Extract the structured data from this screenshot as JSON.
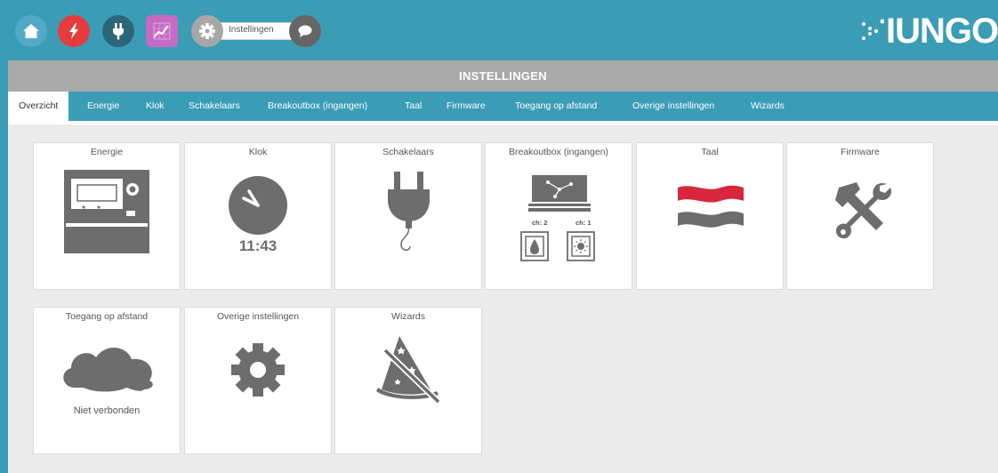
{
  "colors": {
    "header": "#3b9cb5",
    "titlebar": "#a9a9a9",
    "icon_gray": "#6d6d6d",
    "background": "#ececec"
  },
  "nav": {
    "buttons": [
      {
        "icon": "home-icon",
        "color": "#52a9c6"
      },
      {
        "icon": "lightning-icon",
        "color": "#e63b3e"
      },
      {
        "icon": "plug-icon",
        "color": "#2d6678"
      },
      {
        "icon": "chart-icon",
        "color": "#c56bc4"
      }
    ],
    "settings_label": "Instellingen"
  },
  "logo": {
    "text": "IUNGO"
  },
  "page_title": "INSTELLINGEN",
  "tabs": [
    {
      "label": "Overzicht",
      "active": true
    },
    {
      "label": "Energie"
    },
    {
      "label": "Klok"
    },
    {
      "label": "Schakelaars"
    },
    {
      "label": "Breakoutbox (ingangen)"
    },
    {
      "label": "Taal"
    },
    {
      "label": "Firmware"
    },
    {
      "label": "Toegang op afstand"
    },
    {
      "label": "Overige instellingen"
    },
    {
      "label": "Wizards"
    }
  ],
  "tiles": {
    "energie": {
      "title": "Energie"
    },
    "klok": {
      "title": "Klok",
      "time": "11:43"
    },
    "schakelaars": {
      "title": "Schakelaars"
    },
    "breakoutbox": {
      "title": "Breakoutbox (ingangen)",
      "ch_left": "ch: 2",
      "ch_right": "ch: 1"
    },
    "taal": {
      "title": "Taal"
    },
    "firmware": {
      "title": "Firmware"
    },
    "toegang": {
      "title": "Toegang op afstand",
      "status": "Niet verbonden"
    },
    "overige": {
      "title": "Overige instellingen"
    },
    "wizards": {
      "title": "Wizards"
    }
  }
}
